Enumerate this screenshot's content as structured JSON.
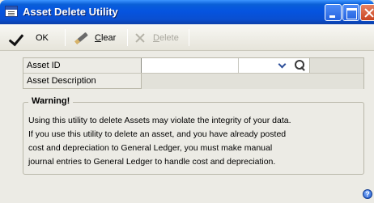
{
  "window": {
    "title": "Asset Delete Utility"
  },
  "toolbar": {
    "ok_label": "OK",
    "clear_label_pre": "C",
    "clear_label_post": "lear",
    "delete_label_pre": "D",
    "delete_label_post": "elete"
  },
  "form": {
    "asset_id_label": "Asset ID",
    "asset_id_value": "",
    "asset_description_label": "Asset Description",
    "asset_description_value": ""
  },
  "warning": {
    "title": "Warning!",
    "lines": [
      "Using this utility to delete Assets may violate the integrity of your data.",
      "If you use this utility to delete an asset, and you have already posted",
      "cost and depreciation to General Ledger,  you must make manual",
      "journal entries to General Ledger to handle cost and depreciation."
    ]
  },
  "help": {
    "glyph": "?"
  },
  "icons": {
    "window_icon": "window-app-icon",
    "ok": "checkmark-icon",
    "clear": "eraser-icon",
    "delete": "delete-x-icon",
    "lookup": "magnifier-icon",
    "dropdown": "chevron-down-icon",
    "help": "help-icon"
  },
  "colors": {
    "titlebar": "#0554e0",
    "window_bg": "#ecebe5",
    "disabled_text": "#a9a79e"
  }
}
